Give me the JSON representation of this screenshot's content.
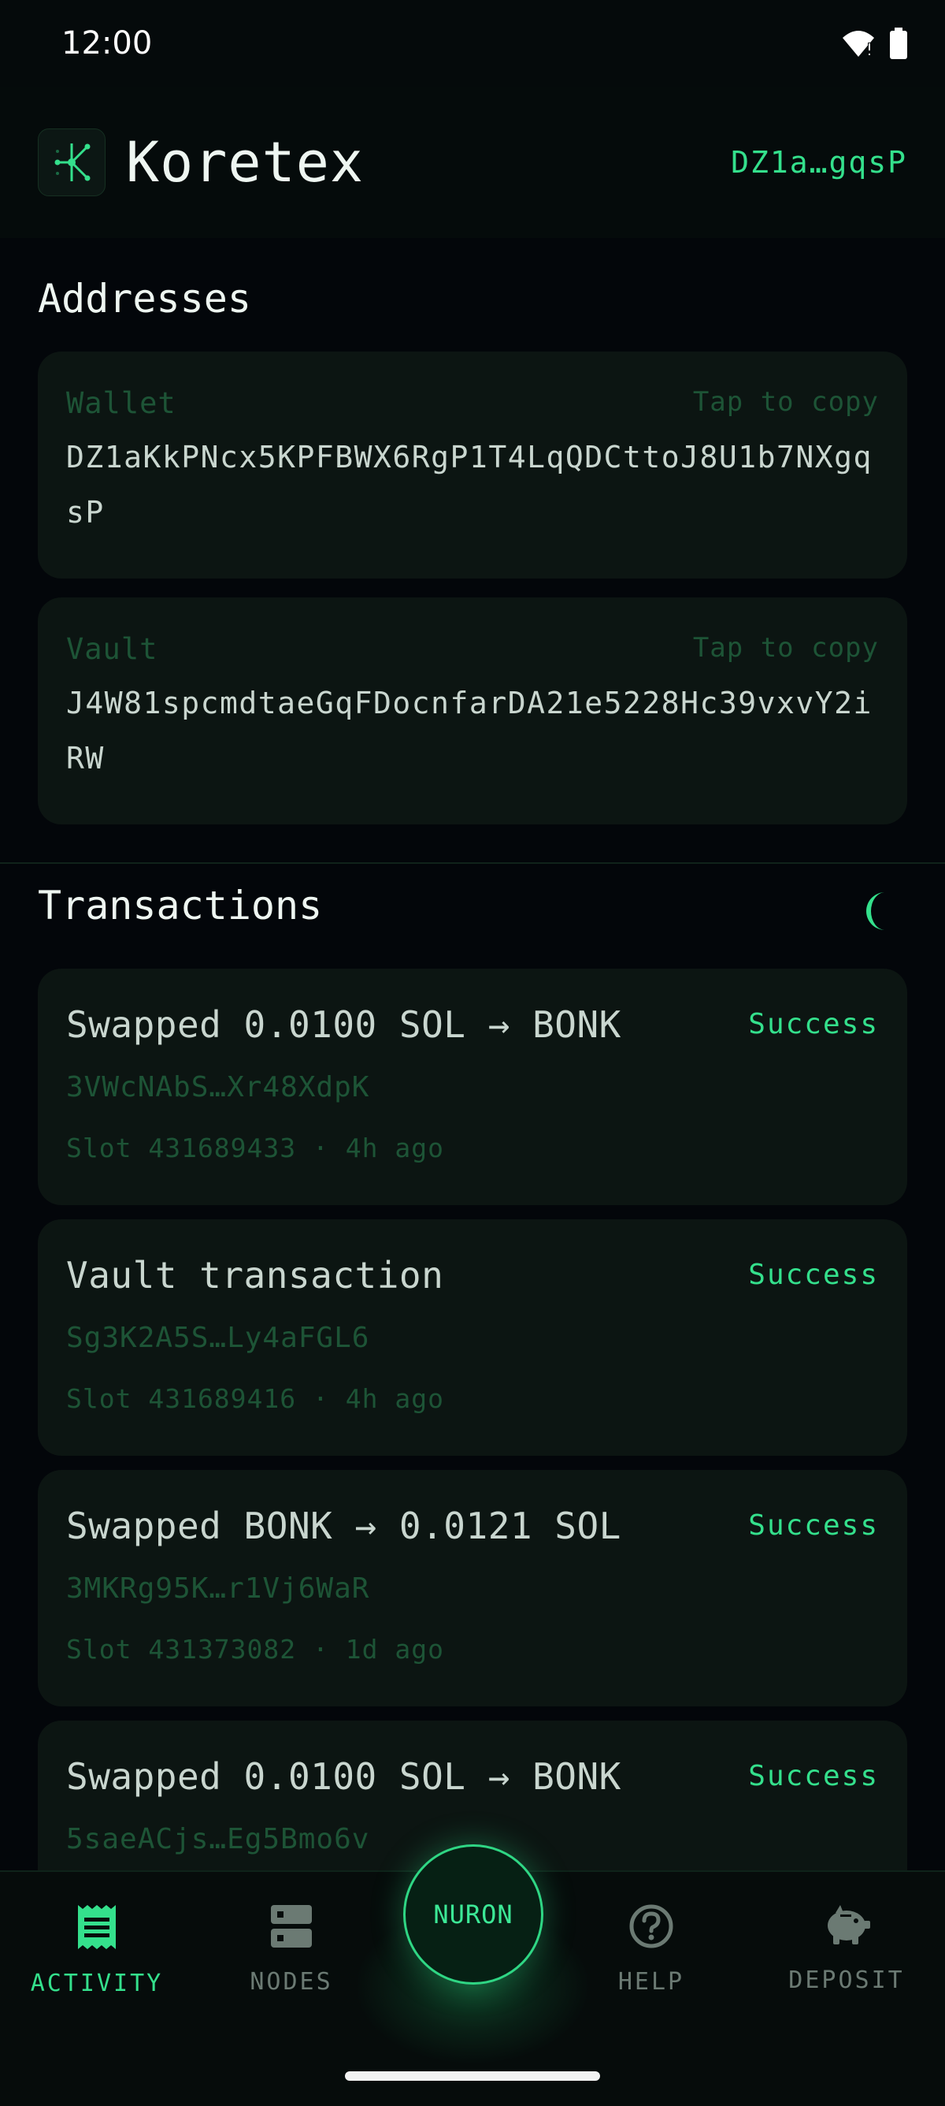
{
  "status_bar": {
    "time": "12:00"
  },
  "header": {
    "title": "Koretex",
    "wallet_short": "DZ1a…gqsP"
  },
  "addresses": {
    "title": "Addresses",
    "items": [
      {
        "label": "Wallet",
        "copy_hint": "Tap to copy",
        "value": "DZ1aKkPNcx5KPFBWX6RgP1T4LqQDCttoJ8U1b7NXgqsP"
      },
      {
        "label": "Vault",
        "copy_hint": "Tap to copy",
        "value": "J4W81spcmdtaeGqFDocnfarDA21e5228Hc39vxvY2iRW"
      }
    ]
  },
  "transactions": {
    "title": "Transactions",
    "items": [
      {
        "title": "Swapped 0.0100 SOL → BONK",
        "status": "Success",
        "hash": "3VWcNAbS…Xr48XdpK",
        "meta": "Slot 431689433 · 4h ago"
      },
      {
        "title": "Vault transaction",
        "status": "Success",
        "hash": "Sg3K2A5S…Ly4aFGL6",
        "meta": "Slot 431689416 · 4h ago"
      },
      {
        "title": "Swapped BONK → 0.0121 SOL",
        "status": "Success",
        "hash": "3MKRg95K…r1Vj6WaR",
        "meta": "Slot 431373082 · 1d ago"
      },
      {
        "title": "Swapped 0.0100 SOL → BONK",
        "status": "Success",
        "hash": "5saeACjs…Eg5Bmo6v",
        "meta": ""
      }
    ]
  },
  "nav": {
    "items": [
      {
        "label": "ACTIVITY",
        "icon": "receipt-icon",
        "active": true
      },
      {
        "label": "NODES",
        "icon": "server-icon",
        "active": false
      },
      {
        "label": "HELP",
        "icon": "help-circle-icon",
        "active": false
      },
      {
        "label": "DEPOSIT",
        "icon": "piggy-bank-icon",
        "active": false
      }
    ],
    "center_button": "NURON"
  },
  "colors": {
    "accent": "#34e08c",
    "background": "#03060a",
    "card": "#0c1512",
    "muted": "#1d5436"
  }
}
